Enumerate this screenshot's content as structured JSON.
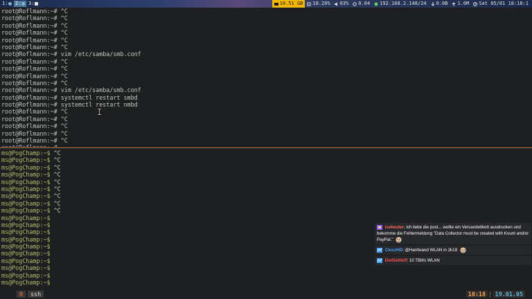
{
  "topbar": {
    "workspaces": [
      "1:",
      "2:",
      "3:"
    ],
    "status": {
      "ram": "10.51 GB",
      "cpu": "18.20%",
      "volume": "03%",
      "load": "0.04",
      "ip": "192.168.2.148/24",
      "net_down": "0.0B",
      "net_up": "1.0M",
      "datetime": "Sat 05/01 18:18:1"
    },
    "colors": {
      "highlight": "#f2b705",
      "active_ws": "#4c7899"
    }
  },
  "terminal_top": {
    "prompt": "root@Roflmann:~#",
    "lines": [
      {
        "cmd": " ^C"
      },
      {
        "cmd": " ^C"
      },
      {
        "cmd": " ^C"
      },
      {
        "cmd": " ^C"
      },
      {
        "cmd": " ^C"
      },
      {
        "cmd": " ^C"
      },
      {
        "cmd": " vim /etc/samba/smb.conf"
      },
      {
        "cmd": " ^C"
      },
      {
        "cmd": " ^C"
      },
      {
        "cmd": " ^C"
      },
      {
        "cmd": " ^C"
      },
      {
        "cmd": " vim /etc/samba/smb.conf"
      },
      {
        "cmd": " systemctl restart smbd"
      },
      {
        "cmd": " systemctl restart nmbd"
      },
      {
        "cmd": " ^C"
      },
      {
        "cmd": " ^C"
      },
      {
        "cmd": " ^C"
      },
      {
        "cmd": " ^C"
      },
      {
        "cmd": " ^C"
      },
      {
        "cmd": " "
      }
    ]
  },
  "terminal_bottom": {
    "prompt": "ms@PogChamp:~$",
    "lines": [
      {
        "cmd": " ^C"
      },
      {
        "cmd": " ^C"
      },
      {
        "cmd": " ^C"
      },
      {
        "cmd": " ^C"
      },
      {
        "cmd": " ^C"
      },
      {
        "cmd": " ^C"
      },
      {
        "cmd": " ^C"
      },
      {
        "cmd": " ^C"
      },
      {
        "cmd": " ^C"
      },
      {
        "cmd": " "
      },
      {
        "cmd": " "
      },
      {
        "cmd": " "
      },
      {
        "cmd": " "
      },
      {
        "cmd": " "
      },
      {
        "cmd": " "
      },
      {
        "cmd": " "
      },
      {
        "cmd": " "
      },
      {
        "cmd": " "
      },
      {
        "cmd": " "
      }
    ]
  },
  "tmux": {
    "window_number": "0",
    "window_name": "ssh",
    "time": "18:18",
    "separator": "|",
    "date": "19.01.05"
  },
  "chat": {
    "messages": [
      {
        "user": "icekeuter",
        "user_color": "#ff6b5a",
        "text": ": ich liebe die post... wollte ein Versandetikett ausdrucken und bekomme die Fehlermeldung \"Data Collector must be created with Kount and/or PayPal.\""
      },
      {
        "user": "CloczHD",
        "user_color": "#4aa3ff",
        "text": ": @Hanfwand WLAN in 2k19"
      },
      {
        "user": "DerDettleff",
        "user_color": "#ff5050",
        "text": ": 10 TBit/s WLAN"
      }
    ]
  }
}
